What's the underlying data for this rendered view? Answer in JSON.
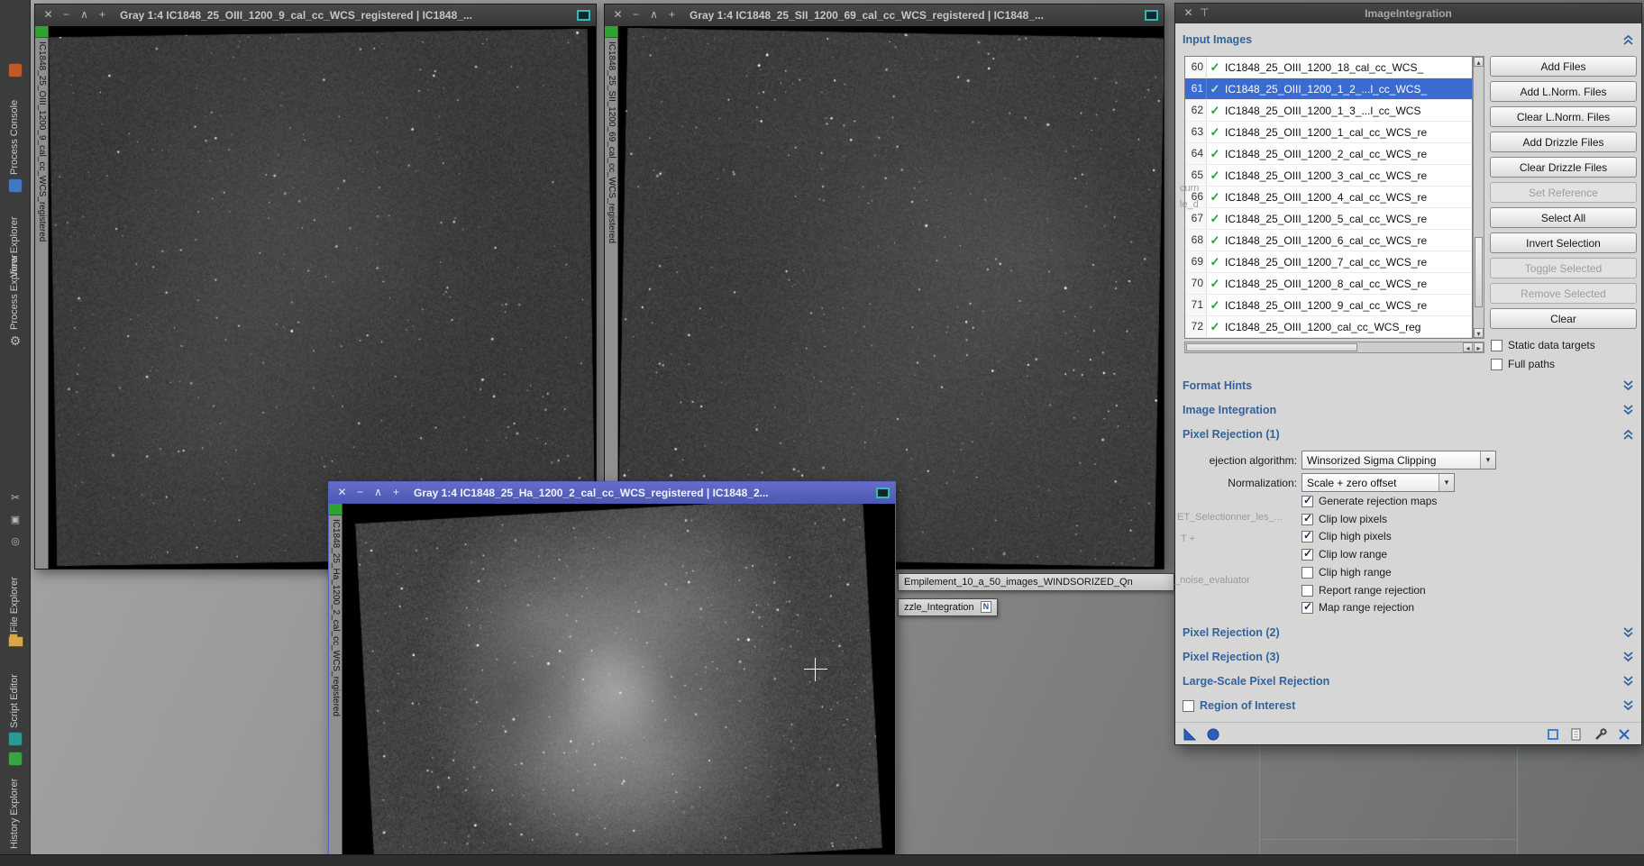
{
  "icons": {
    "close": "✕",
    "iconize": "−",
    "shade": "∧",
    "zoom": "+",
    "pin": "⊤",
    "check": "✓",
    "combo_arrow": "▾",
    "up": "▴",
    "down": "▾",
    "left": "◂",
    "right": "▸",
    "gear": "⚙",
    "scissors": "✂",
    "grid": "▣",
    "target": "◎"
  },
  "colors": {
    "accent_blue": "#33639c",
    "selection_blue": "#3a6bd0",
    "check_green": "#1fa321",
    "active_title": "#5560bd",
    "screen_icon_teal": "#35b8b8"
  },
  "sidebar": {
    "items": [
      "Process Console",
      "View Explorer",
      "Process Explorer",
      "File Explorer",
      "Script Editor",
      "History Explorer"
    ]
  },
  "windows": [
    {
      "title": "Gray 1:4 IC1848_25_OIII_1200_9_cal_cc_WCS_registered | IC1848_...",
      "side_label": "IC1848_25_OIII_1200_9_cal_cc_WCS_registered"
    },
    {
      "title": "Gray 1:4 IC1848_25_SII_1200_69_cal_cc_WCS_registered | IC1848_...",
      "side_label": "IC1848_25_SII_1200_69_cal_cc_WCS_registered"
    },
    {
      "title": "Gray 1:4 IC1848_25_Ha_1200_2_cal_cc_WCS_registered | IC1848_2...",
      "side_label": "IC1848_25_Ha_1200_2_cal_cc_WCS_registered"
    }
  ],
  "workspace": {
    "float_labels": [
      {
        "text": "Empilement_10_a_50_images_WINDSORIZED_Qn",
        "badge": ""
      },
      {
        "text": "zzle_Integration",
        "badge": "N"
      }
    ],
    "ghosts": [
      "curn",
      "le_d",
      "ET_Selectionner_les_...",
      "T +",
      "_noise_evaluator"
    ]
  },
  "dialog": {
    "title": "ImageIntegration",
    "input_images": {
      "header": "Input Images",
      "selected_num": 61,
      "rows": [
        {
          "num": 60,
          "checked": true,
          "file": "IC1848_25_OIII_1200_18_cal_cc_WCS_"
        },
        {
          "num": 61,
          "checked": true,
          "file": "IC1848_25_OIII_1200_1_2_...l_cc_WCS_"
        },
        {
          "num": 62,
          "checked": true,
          "file": "IC1848_25_OIII_1200_1_3_...l_cc_WCS"
        },
        {
          "num": 63,
          "checked": true,
          "file": "IC1848_25_OIII_1200_1_cal_cc_WCS_re"
        },
        {
          "num": 64,
          "checked": true,
          "file": "IC1848_25_OIII_1200_2_cal_cc_WCS_re"
        },
        {
          "num": 65,
          "checked": true,
          "file": "IC1848_25_OIII_1200_3_cal_cc_WCS_re"
        },
        {
          "num": 66,
          "checked": true,
          "file": "IC1848_25_OIII_1200_4_cal_cc_WCS_re"
        },
        {
          "num": 67,
          "checked": true,
          "file": "IC1848_25_OIII_1200_5_cal_cc_WCS_re"
        },
        {
          "num": 68,
          "checked": true,
          "file": "IC1848_25_OIII_1200_6_cal_cc_WCS_re"
        },
        {
          "num": 69,
          "checked": true,
          "file": "IC1848_25_OIII_1200_7_cal_cc_WCS_re"
        },
        {
          "num": 70,
          "checked": true,
          "file": "IC1848_25_OIII_1200_8_cal_cc_WCS_re"
        },
        {
          "num": 71,
          "checked": true,
          "file": "IC1848_25_OIII_1200_9_cal_cc_WCS_re"
        },
        {
          "num": 72,
          "checked": true,
          "file": "IC1848_25_OIII_1200_cal_cc_WCS_reg"
        }
      ],
      "buttons": [
        {
          "label": "Add Files",
          "enabled": true
        },
        {
          "label": "Add L.Norm. Files",
          "enabled": true
        },
        {
          "label": "Clear L.Norm. Files",
          "enabled": true
        },
        {
          "label": "Add Drizzle Files",
          "enabled": true
        },
        {
          "label": "Clear Drizzle Files",
          "enabled": true
        },
        {
          "label": "Set Reference",
          "enabled": false
        },
        {
          "label": "Select All",
          "enabled": true
        },
        {
          "label": "Invert Selection",
          "enabled": true
        },
        {
          "label": "Toggle Selected",
          "enabled": false
        },
        {
          "label": "Remove Selected",
          "enabled": false
        },
        {
          "label": "Clear",
          "enabled": true
        }
      ],
      "static_data_targets": {
        "label": "Static data targets",
        "checked": false
      },
      "full_paths": {
        "label": "Full paths",
        "checked": false
      }
    },
    "sections": {
      "format_hints": "Format Hints",
      "image_integration": "Image Integration",
      "pixel_rejection_1": "Pixel Rejection (1)",
      "pixel_rejection_2": "Pixel Rejection (2)",
      "pixel_rejection_3": "Pixel Rejection (3)",
      "large_scale": "Large-Scale Pixel Rejection",
      "region_of_interest": "Region of Interest"
    },
    "pixel_rejection_1": {
      "algorithm_label": "ejection algorithm:",
      "algorithm_value": "Winsorized Sigma Clipping",
      "normalization_label": "Normalization:",
      "normalization_value": "Scale + zero offset",
      "options": [
        {
          "label": "Generate rejection maps",
          "checked": true
        },
        {
          "label": "Clip low pixels",
          "checked": true
        },
        {
          "label": "Clip high pixels",
          "checked": true
        },
        {
          "label": "Clip low range",
          "checked": true
        },
        {
          "label": "Clip high range",
          "checked": false
        },
        {
          "label": "Report range rejection",
          "checked": false
        },
        {
          "label": "Map range rejection",
          "checked": true
        }
      ]
    }
  }
}
